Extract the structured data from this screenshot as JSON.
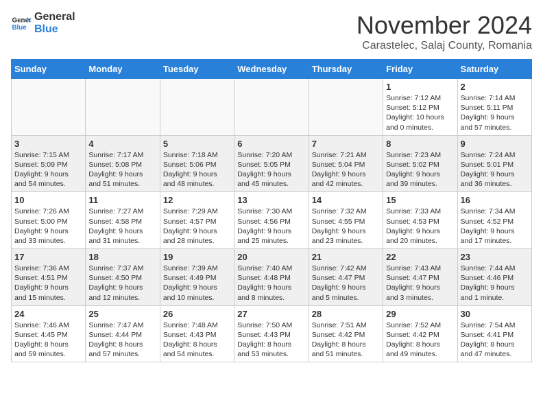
{
  "header": {
    "logo_general": "General",
    "logo_blue": "Blue",
    "month": "November 2024",
    "location": "Carastelec, Salaj County, Romania"
  },
  "weekdays": [
    "Sunday",
    "Monday",
    "Tuesday",
    "Wednesday",
    "Thursday",
    "Friday",
    "Saturday"
  ],
  "weeks": [
    [
      {
        "day": "",
        "info": ""
      },
      {
        "day": "",
        "info": ""
      },
      {
        "day": "",
        "info": ""
      },
      {
        "day": "",
        "info": ""
      },
      {
        "day": "",
        "info": ""
      },
      {
        "day": "1",
        "info": "Sunrise: 7:12 AM\nSunset: 5:12 PM\nDaylight: 10 hours\nand 0 minutes."
      },
      {
        "day": "2",
        "info": "Sunrise: 7:14 AM\nSunset: 5:11 PM\nDaylight: 9 hours\nand 57 minutes."
      }
    ],
    [
      {
        "day": "3",
        "info": "Sunrise: 7:15 AM\nSunset: 5:09 PM\nDaylight: 9 hours\nand 54 minutes."
      },
      {
        "day": "4",
        "info": "Sunrise: 7:17 AM\nSunset: 5:08 PM\nDaylight: 9 hours\nand 51 minutes."
      },
      {
        "day": "5",
        "info": "Sunrise: 7:18 AM\nSunset: 5:06 PM\nDaylight: 9 hours\nand 48 minutes."
      },
      {
        "day": "6",
        "info": "Sunrise: 7:20 AM\nSunset: 5:05 PM\nDaylight: 9 hours\nand 45 minutes."
      },
      {
        "day": "7",
        "info": "Sunrise: 7:21 AM\nSunset: 5:04 PM\nDaylight: 9 hours\nand 42 minutes."
      },
      {
        "day": "8",
        "info": "Sunrise: 7:23 AM\nSunset: 5:02 PM\nDaylight: 9 hours\nand 39 minutes."
      },
      {
        "day": "9",
        "info": "Sunrise: 7:24 AM\nSunset: 5:01 PM\nDaylight: 9 hours\nand 36 minutes."
      }
    ],
    [
      {
        "day": "10",
        "info": "Sunrise: 7:26 AM\nSunset: 5:00 PM\nDaylight: 9 hours\nand 33 minutes."
      },
      {
        "day": "11",
        "info": "Sunrise: 7:27 AM\nSunset: 4:58 PM\nDaylight: 9 hours\nand 31 minutes."
      },
      {
        "day": "12",
        "info": "Sunrise: 7:29 AM\nSunset: 4:57 PM\nDaylight: 9 hours\nand 28 minutes."
      },
      {
        "day": "13",
        "info": "Sunrise: 7:30 AM\nSunset: 4:56 PM\nDaylight: 9 hours\nand 25 minutes."
      },
      {
        "day": "14",
        "info": "Sunrise: 7:32 AM\nSunset: 4:55 PM\nDaylight: 9 hours\nand 23 minutes."
      },
      {
        "day": "15",
        "info": "Sunrise: 7:33 AM\nSunset: 4:53 PM\nDaylight: 9 hours\nand 20 minutes."
      },
      {
        "day": "16",
        "info": "Sunrise: 7:34 AM\nSunset: 4:52 PM\nDaylight: 9 hours\nand 17 minutes."
      }
    ],
    [
      {
        "day": "17",
        "info": "Sunrise: 7:36 AM\nSunset: 4:51 PM\nDaylight: 9 hours\nand 15 minutes."
      },
      {
        "day": "18",
        "info": "Sunrise: 7:37 AM\nSunset: 4:50 PM\nDaylight: 9 hours\nand 12 minutes."
      },
      {
        "day": "19",
        "info": "Sunrise: 7:39 AM\nSunset: 4:49 PM\nDaylight: 9 hours\nand 10 minutes."
      },
      {
        "day": "20",
        "info": "Sunrise: 7:40 AM\nSunset: 4:48 PM\nDaylight: 9 hours\nand 8 minutes."
      },
      {
        "day": "21",
        "info": "Sunrise: 7:42 AM\nSunset: 4:47 PM\nDaylight: 9 hours\nand 5 minutes."
      },
      {
        "day": "22",
        "info": "Sunrise: 7:43 AM\nSunset: 4:47 PM\nDaylight: 9 hours\nand 3 minutes."
      },
      {
        "day": "23",
        "info": "Sunrise: 7:44 AM\nSunset: 4:46 PM\nDaylight: 9 hours\nand 1 minute."
      }
    ],
    [
      {
        "day": "24",
        "info": "Sunrise: 7:46 AM\nSunset: 4:45 PM\nDaylight: 8 hours\nand 59 minutes."
      },
      {
        "day": "25",
        "info": "Sunrise: 7:47 AM\nSunset: 4:44 PM\nDaylight: 8 hours\nand 57 minutes."
      },
      {
        "day": "26",
        "info": "Sunrise: 7:48 AM\nSunset: 4:43 PM\nDaylight: 8 hours\nand 54 minutes."
      },
      {
        "day": "27",
        "info": "Sunrise: 7:50 AM\nSunset: 4:43 PM\nDaylight: 8 hours\nand 53 minutes."
      },
      {
        "day": "28",
        "info": "Sunrise: 7:51 AM\nSunset: 4:42 PM\nDaylight: 8 hours\nand 51 minutes."
      },
      {
        "day": "29",
        "info": "Sunrise: 7:52 AM\nSunset: 4:42 PM\nDaylight: 8 hours\nand 49 minutes."
      },
      {
        "day": "30",
        "info": "Sunrise: 7:54 AM\nSunset: 4:41 PM\nDaylight: 8 hours\nand 47 minutes."
      }
    ]
  ]
}
